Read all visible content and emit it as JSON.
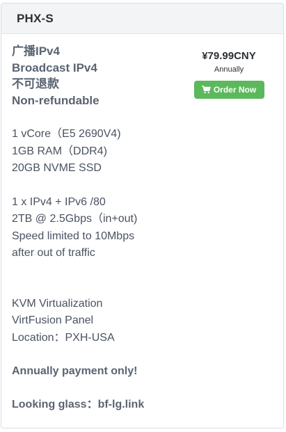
{
  "product": {
    "title": "PHX-S",
    "headline": [
      "广播IPv4",
      "Broadcast IPv4",
      "不可退款",
      "Non-refundable"
    ],
    "price": "¥79.99CNY",
    "billing_cycle": "Annually",
    "order_button_label": "Order Now",
    "order_button_icon": "shopping-cart-icon",
    "accent_color": "#5cb85c"
  },
  "specs": {
    "hardware": [
      "1 vCore（E5 2690V4)",
      "1GB RAM（DDR4)",
      "20GB NVME SSD"
    ],
    "network": [
      "1 x IPv4 + IPv6 /80",
      "2TB @ 2.5Gbps（in+out)",
      "Speed limited to 10Mbps",
      "after out of traffic"
    ],
    "platform": [
      "KVM Virtualization",
      "VirtFusion Panel",
      "Location：PXH-USA"
    ]
  },
  "notes": {
    "payment": "Annually payment only!",
    "looking_glass": "Looking glass：bf-lg.link"
  }
}
